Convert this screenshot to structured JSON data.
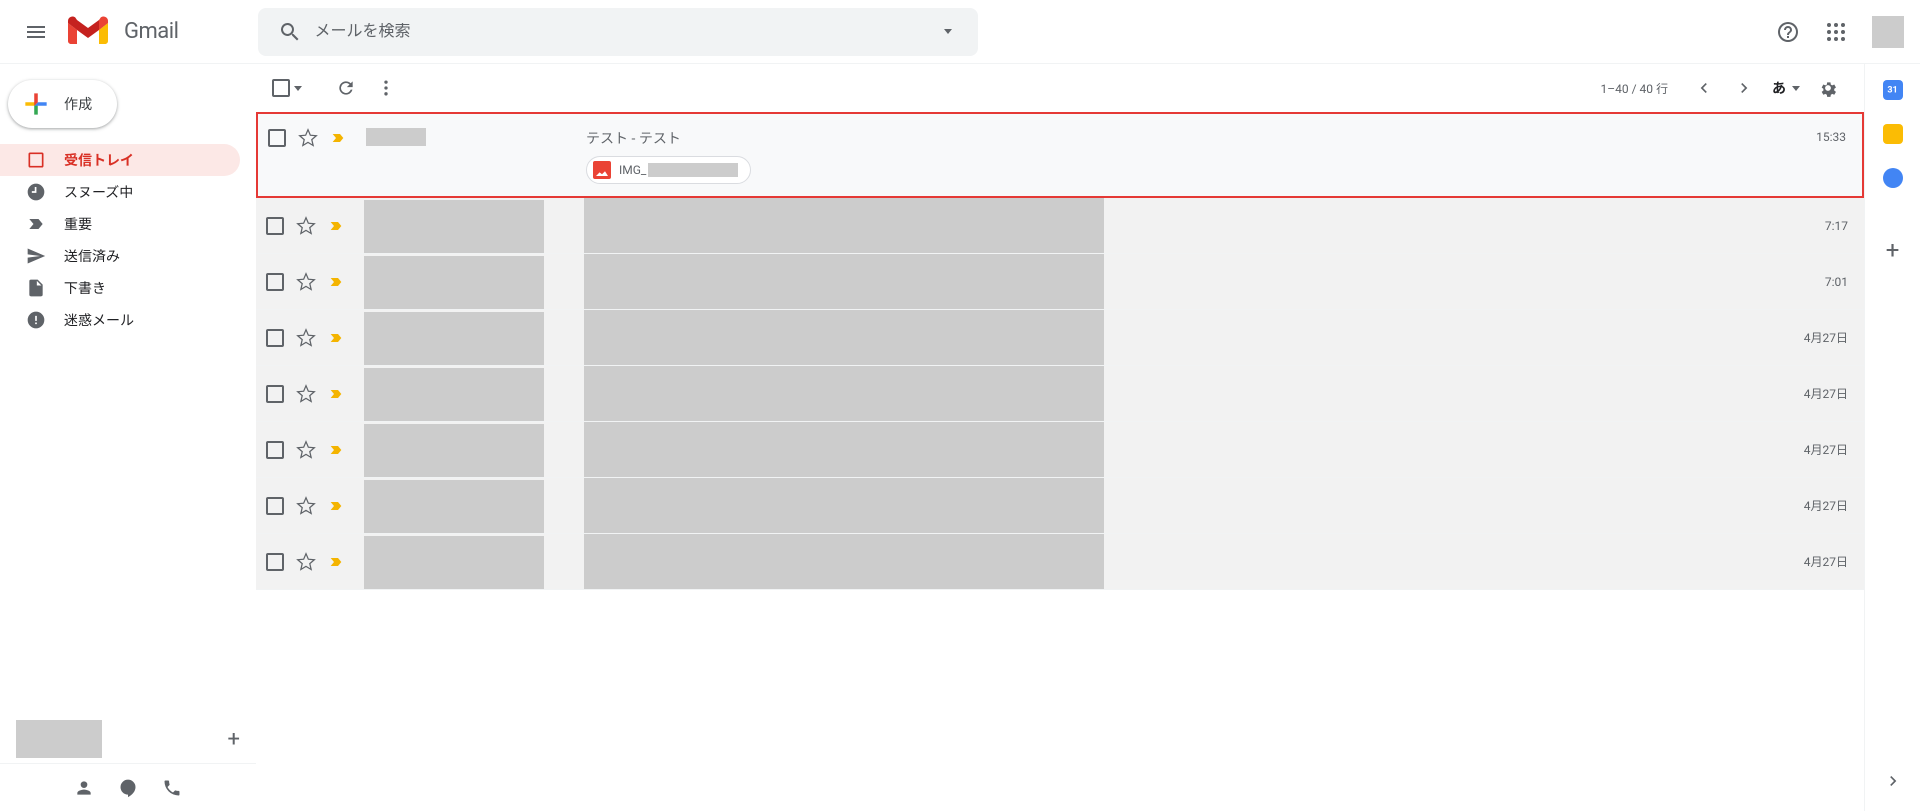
{
  "header": {
    "product": "Gmail",
    "search_placeholder": "メールを検索"
  },
  "compose_label": "作成",
  "sidebar": {
    "items": [
      {
        "label": "受信トレイ"
      },
      {
        "label": "スヌーズ中"
      },
      {
        "label": "重要"
      },
      {
        "label": "送信済み"
      },
      {
        "label": "下書き"
      },
      {
        "label": "迷惑メール"
      }
    ]
  },
  "toolbar": {
    "page_info": "1–40 / 40 行",
    "lang": "あ"
  },
  "emails": [
    {
      "subject": "テスト - テスト",
      "attachment_prefix": "IMG_",
      "time": "15:33",
      "highlighted": true
    },
    {
      "time": "7:17"
    },
    {
      "time": "7:01"
    },
    {
      "time": "4月27日"
    },
    {
      "time": "4月27日"
    },
    {
      "time": "4月27日"
    },
    {
      "time": "4月27日"
    },
    {
      "time": "4月27日"
    }
  ]
}
